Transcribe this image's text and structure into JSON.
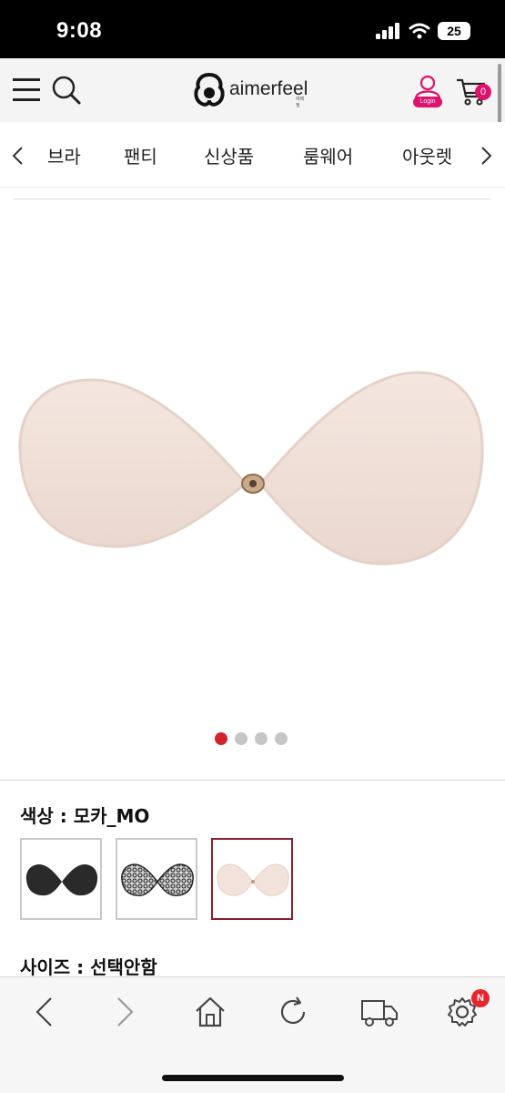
{
  "status_bar": {
    "time": "9:08",
    "battery": "25"
  },
  "header": {
    "logo_text": "aimerfeel",
    "logo_sub": "에메필",
    "login_label": "Login",
    "cart_count": "0"
  },
  "categories": [
    "브라",
    "팬티",
    "신상품",
    "룸웨어",
    "아웃렛"
  ],
  "product": {
    "color_label": "색상 : 모카_MO",
    "size_label": "사이즈 : 선택안함",
    "image_dots": {
      "total": 4,
      "active_index": 0
    },
    "swatches": [
      {
        "name": "black",
        "selected": false
      },
      {
        "name": "black-lace",
        "selected": false
      },
      {
        "name": "mocha",
        "selected": true
      }
    ]
  },
  "colors": {
    "accent_pink": "#e0116b",
    "dot_active": "#d3242c",
    "selected_border": "#8b1f2a"
  },
  "icons": [
    "menu-icon",
    "search-icon",
    "user-icon",
    "cart-icon",
    "chevron-left-icon",
    "chevron-right-icon",
    "back-icon",
    "forward-icon",
    "home-icon",
    "refresh-icon",
    "delivery-truck-icon",
    "settings-gear-icon"
  ]
}
